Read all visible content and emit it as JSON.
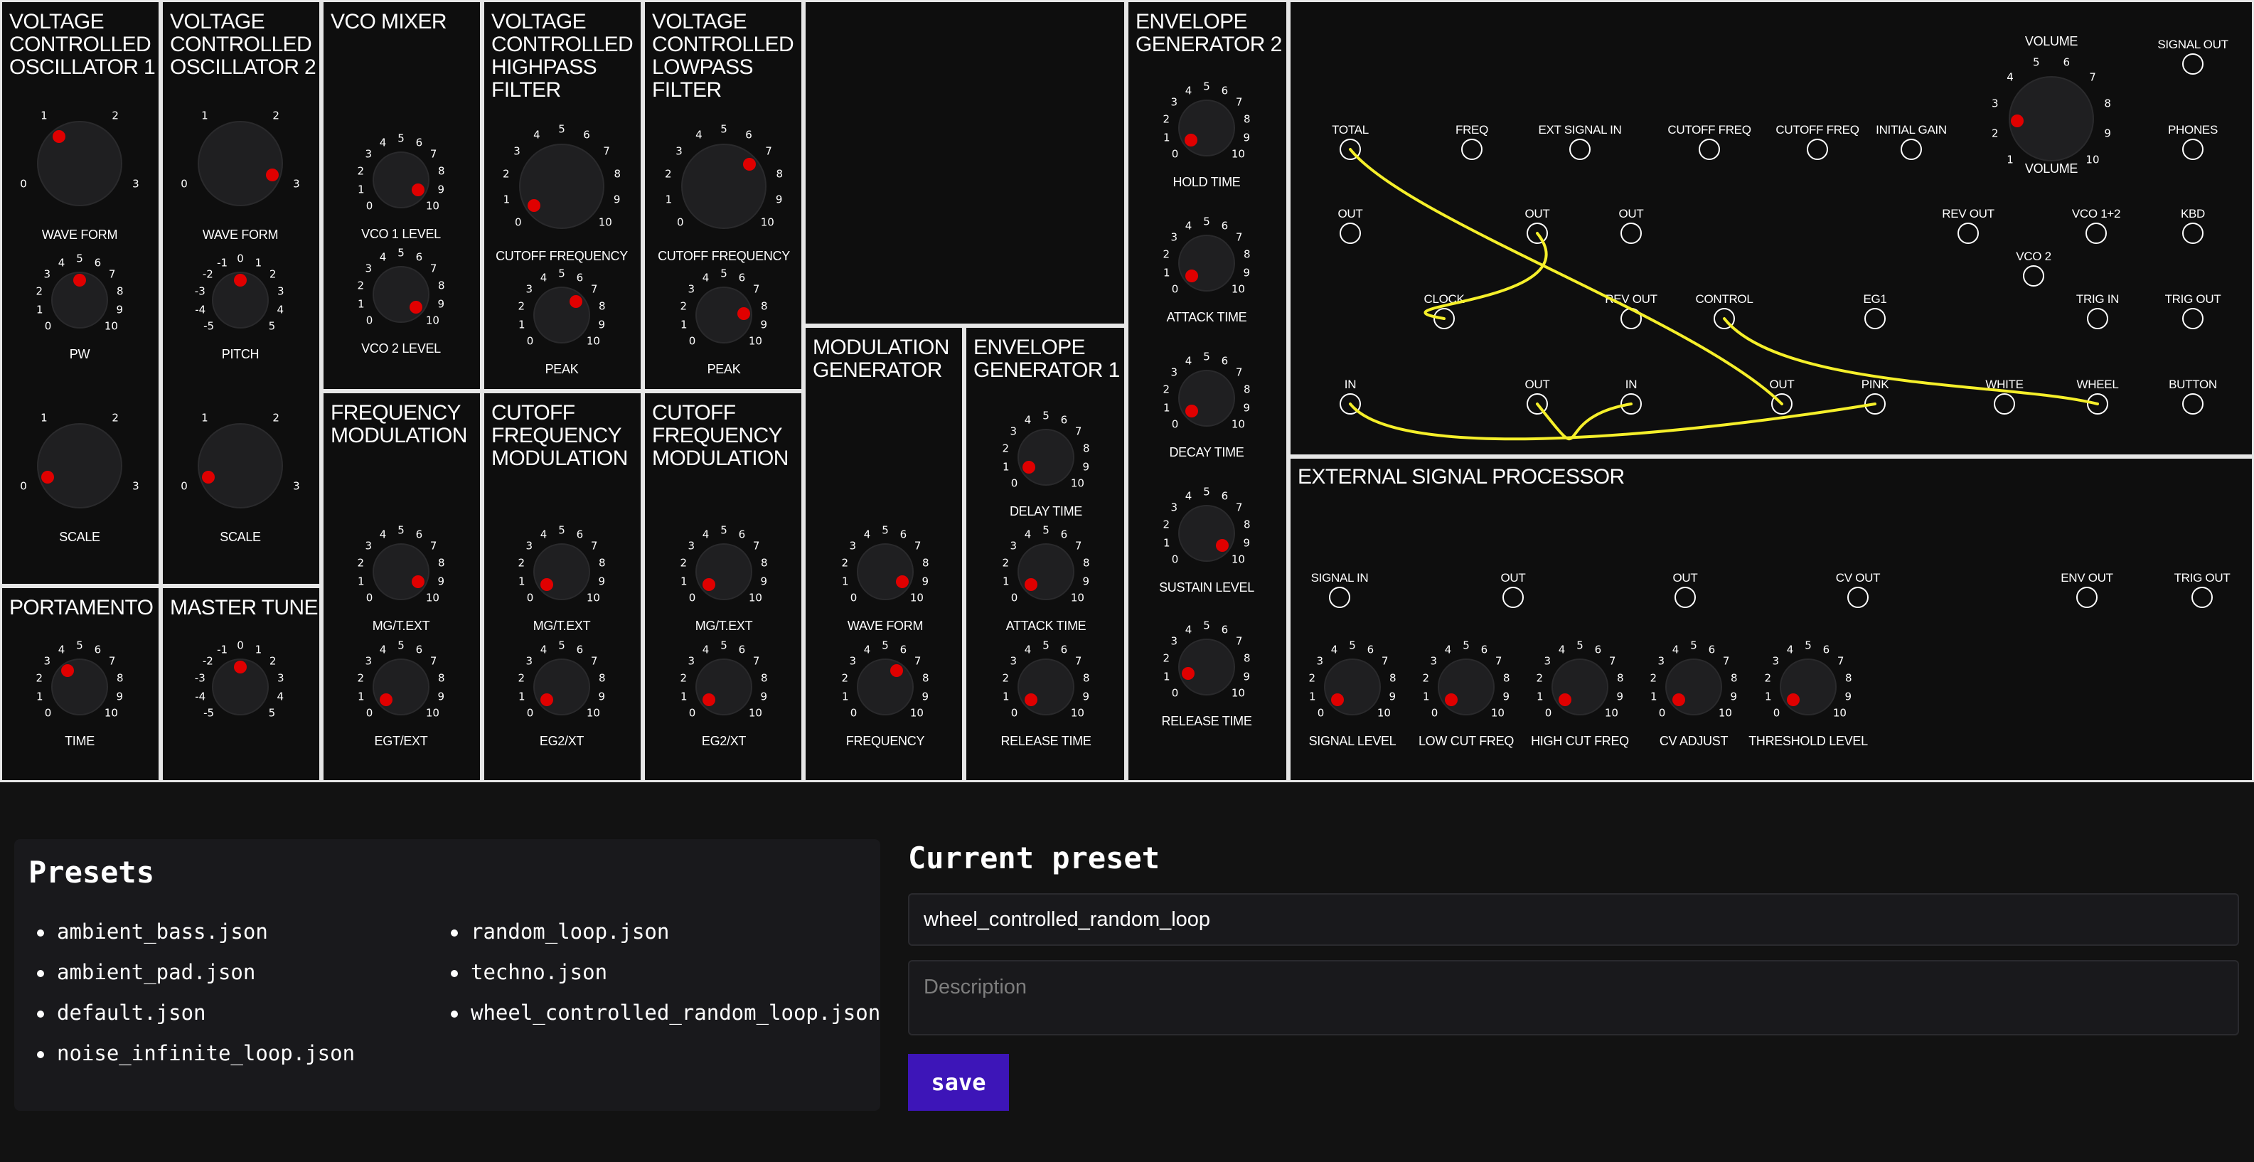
{
  "colors": {
    "background": "#121212",
    "panel": "#0e0e0e",
    "border": "#e6e6e6",
    "knob": "#1f1f21",
    "indicator": "#e00000",
    "cable": "#f5ef2a",
    "save_button": "#3d15b8"
  },
  "modules": {
    "vco1": {
      "title": "VOLTAGE\nCONTROLLED\nOSCILLATOR 1",
      "knobs": [
        {
          "label": "WAVE FORM",
          "ticks": [
            "0",
            "1",
            "2",
            "3"
          ],
          "value": 1
        },
        {
          "label": "PW",
          "ticks": [
            "0",
            "1",
            "2",
            "3",
            "4",
            "5",
            "6",
            "7",
            "8",
            "9",
            "10"
          ],
          "value": 5
        },
        {
          "label": "SCALE",
          "ticks": [
            "0",
            "1",
            "2",
            "3"
          ],
          "value": 0
        }
      ]
    },
    "vco2": {
      "title": "VOLTAGE\nCONTROLLED\nOSCILLATOR 2",
      "knobs": [
        {
          "label": "WAVE FORM",
          "ticks": [
            "0",
            "1",
            "2",
            "3"
          ],
          "value": 3
        },
        {
          "label": "PITCH",
          "ticks": [
            "-5",
            "-4",
            "-3",
            "-2",
            "-1",
            "0",
            "1",
            "2",
            "3",
            "4",
            "5"
          ],
          "value": 0
        },
        {
          "label": "SCALE",
          "ticks": [
            "0",
            "1",
            "2",
            "3"
          ],
          "value": 0
        }
      ]
    },
    "vco_mixer": {
      "title": "VCO MIXER",
      "knobs": [
        {
          "label": "VCO 1 LEVEL",
          "ticks": [
            "0",
            "1",
            "2",
            "3",
            "4",
            "5",
            "6",
            "7",
            "8",
            "9",
            "10"
          ],
          "value": 9.6
        },
        {
          "label": "VCO 2 LEVEL",
          "ticks": [
            "0",
            "1",
            "2",
            "3",
            "4",
            "5",
            "6",
            "7",
            "8",
            "9",
            "10"
          ],
          "value": 10
        }
      ]
    },
    "vchpf": {
      "title": "VOLTAGE\nCONTROLLED\nHIGHPASS\nFILTER",
      "knobs": [
        {
          "label": "CUTOFF FREQUENCY",
          "ticks": [
            "0",
            "1",
            "2",
            "3",
            "4",
            "5",
            "6",
            "7",
            "8",
            "9",
            "10"
          ],
          "value": 0.2
        },
        {
          "label": "PEAK",
          "ticks": [
            "0",
            "1",
            "2",
            "3",
            "4",
            "5",
            "6",
            "7",
            "8",
            "9",
            "10"
          ],
          "value": 6.8
        }
      ]
    },
    "vclpf": {
      "title": "VOLTAGE\nCONTROLLED\nLOWPASS\nFILTER",
      "knobs": [
        {
          "label": "CUTOFF FREQUENCY",
          "ticks": [
            "0",
            "1",
            "2",
            "3",
            "4",
            "5",
            "6",
            "7",
            "8",
            "9",
            "10"
          ],
          "value": 6.9
        },
        {
          "label": "PEAK",
          "ticks": [
            "0",
            "1",
            "2",
            "3",
            "4",
            "5",
            "6",
            "7",
            "8",
            "9",
            "10"
          ],
          "value": 8.3
        }
      ]
    },
    "portamento": {
      "title": "PORTAMENTO",
      "knobs": [
        {
          "label": "TIME",
          "ticks": [
            "0",
            "1",
            "2",
            "3",
            "4",
            "5",
            "6",
            "7",
            "8",
            "9",
            "10"
          ],
          "value": 3.6
        }
      ]
    },
    "master_tune": {
      "title": "MASTER TUNE",
      "knobs": [
        {
          "label": "",
          "ticks": [
            "-5",
            "-4",
            "-3",
            "-2",
            "-1",
            "0",
            "1",
            "2",
            "3",
            "4",
            "5"
          ],
          "value": 0
        }
      ]
    },
    "freq_mod": {
      "title": "FREQUENCY\nMODULATION",
      "knobs": [
        {
          "label": "MG/T.EXT",
          "ticks": [
            "0",
            "1",
            "2",
            "3",
            "4",
            "5",
            "6",
            "7",
            "8",
            "9",
            "10"
          ],
          "value": 9.6
        },
        {
          "label": "EGT/EXT",
          "ticks": [
            "0",
            "1",
            "2",
            "3",
            "4",
            "5",
            "6",
            "7",
            "8",
            "9",
            "10"
          ],
          "value": 0
        }
      ]
    },
    "cutoff_mod1": {
      "title": "CUTOFF\nFREQUENCY\nMODULATION",
      "knobs": [
        {
          "label": "MG/T.EXT",
          "ticks": [
            "0",
            "1",
            "2",
            "3",
            "4",
            "5",
            "6",
            "7",
            "8",
            "9",
            "10"
          ],
          "value": 0
        },
        {
          "label": "EG2/XT",
          "ticks": [
            "0",
            "1",
            "2",
            "3",
            "4",
            "5",
            "6",
            "7",
            "8",
            "9",
            "10"
          ],
          "value": 0
        }
      ]
    },
    "cutoff_mod2": {
      "title": "CUTOFF\nFREQUENCY\nMODULATION",
      "knobs": [
        {
          "label": "MG/T.EXT",
          "ticks": [
            "0",
            "1",
            "2",
            "3",
            "4",
            "5",
            "6",
            "7",
            "8",
            "9",
            "10"
          ],
          "value": 0
        },
        {
          "label": "EG2/XT",
          "ticks": [
            "0",
            "1",
            "2",
            "3",
            "4",
            "5",
            "6",
            "7",
            "8",
            "9",
            "10"
          ],
          "value": 0
        }
      ]
    },
    "mod_gen": {
      "title": "MODULATION\nGENERATOR",
      "knobs": [
        {
          "label": "WAVE FORM",
          "ticks": [
            "0",
            "1",
            "2",
            "3",
            "4",
            "5",
            "6",
            "7",
            "8",
            "9",
            "10"
          ],
          "value": 9.6
        },
        {
          "label": "FREQUENCY",
          "ticks": [
            "0",
            "1",
            "2",
            "3",
            "4",
            "5",
            "6",
            "7",
            "8",
            "9",
            "10"
          ],
          "value": 6.3
        }
      ]
    },
    "env_gen1": {
      "title": "ENVELOPE\nGENERATOR 1",
      "knobs": [
        {
          "label": "DELAY TIME",
          "ticks": [
            "0",
            "1",
            "2",
            "3",
            "4",
            "5",
            "6",
            "7",
            "8",
            "9",
            "10"
          ],
          "value": 0.4
        },
        {
          "label": "ATTACK TIME",
          "ticks": [
            "0",
            "1",
            "2",
            "3",
            "4",
            "5",
            "6",
            "7",
            "8",
            "9",
            "10"
          ],
          "value": 0
        },
        {
          "label": "RELEASE TIME",
          "ticks": [
            "0",
            "1",
            "2",
            "3",
            "4",
            "5",
            "6",
            "7",
            "8",
            "9",
            "10"
          ],
          "value": 0
        }
      ]
    },
    "env_gen2": {
      "title": "ENVELOPE\nGENERATOR 2",
      "knobs": [
        {
          "label": "HOLD TIME",
          "ticks": [
            "0",
            "1",
            "2",
            "3",
            "4",
            "5",
            "6",
            "7",
            "8",
            "9",
            "10"
          ],
          "value": 0.1
        },
        {
          "label": "ATTACK TIME",
          "ticks": [
            "0",
            "1",
            "2",
            "3",
            "4",
            "5",
            "6",
            "7",
            "8",
            "9",
            "10"
          ],
          "value": 0
        },
        {
          "label": "DECAY TIME",
          "ticks": [
            "0",
            "1",
            "2",
            "3",
            "4",
            "5",
            "6",
            "7",
            "8",
            "9",
            "10"
          ],
          "value": 0
        },
        {
          "label": "SUSTAIN LEVEL",
          "ticks": [
            "0",
            "1",
            "2",
            "3",
            "4",
            "5",
            "6",
            "7",
            "8",
            "9",
            "10"
          ],
          "value": 9.9
        },
        {
          "label": "RELEASE TIME",
          "ticks": [
            "0",
            "1",
            "2",
            "3",
            "4",
            "5",
            "6",
            "7",
            "8",
            "9",
            "10"
          ],
          "value": 0.8
        }
      ]
    },
    "esp": {
      "title": "EXTERNAL SIGNAL PROCESSOR",
      "knobs": [
        {
          "label": "SIGNAL LEVEL",
          "ticks": [
            "0",
            "1",
            "2",
            "3",
            "4",
            "5",
            "6",
            "7",
            "8",
            "9",
            "10"
          ],
          "value": 0
        },
        {
          "label": "LOW CUT FREQ",
          "ticks": [
            "0",
            "1",
            "2",
            "3",
            "4",
            "5",
            "6",
            "7",
            "8",
            "9",
            "10"
          ],
          "value": 0
        },
        {
          "label": "HIGH CUT FREQ",
          "ticks": [
            "0",
            "1",
            "2",
            "3",
            "4",
            "5",
            "6",
            "7",
            "8",
            "9",
            "10"
          ],
          "value": 0
        },
        {
          "label": "CV ADJUST",
          "ticks": [
            "0",
            "1",
            "2",
            "3",
            "4",
            "5",
            "6",
            "7",
            "8",
            "9",
            "10"
          ],
          "value": 0
        },
        {
          "label": "THRESHOLD LEVEL",
          "ticks": [
            "0",
            "1",
            "2",
            "3",
            "4",
            "5",
            "6",
            "7",
            "8",
            "9",
            "10"
          ],
          "value": 0
        }
      ]
    }
  },
  "patchbay": {
    "volume": {
      "label": "VOLUME",
      "ticks": [
        "1",
        "2",
        "3",
        "4",
        "5",
        "6",
        "7",
        "8",
        "9",
        "10"
      ],
      "value": 2.4
    },
    "jacks": [
      "SIGNAL OUT",
      "TOTAL",
      "FREQ",
      "EXT SIGNAL IN",
      "CUTOFF FREQ",
      "CUTOFF FREQ",
      "INITIAL GAIN",
      "PHONES",
      "OUT",
      "OUT",
      "OUT",
      "REV OUT",
      "VCO 1+2",
      "KBD",
      "VCO 2",
      "CLOCK",
      "REV OUT",
      "CONTROL",
      "EG1",
      "TRIG IN",
      "TRIG OUT",
      "IN",
      "OUT",
      "IN",
      "OUT",
      "PINK",
      "WHITE",
      "WHEEL",
      "BUTTON"
    ],
    "cables": [
      {
        "from": "TOTAL",
        "to": "OUT"
      },
      {
        "from": "OUT",
        "to": "CLOCK"
      },
      {
        "from": "IN",
        "to": "PINK"
      },
      {
        "from": "OUT",
        "to": "IN"
      },
      {
        "from": "CONTROL",
        "to": "WHEEL"
      }
    ]
  },
  "esp_jacks": [
    "SIGNAL IN",
    "OUT",
    "OUT",
    "CV OUT",
    "ENV OUT",
    "TRIG OUT"
  ],
  "presets": {
    "heading": "Presets",
    "items": [
      "ambient_bass.json",
      "ambient_pad.json",
      "default.json",
      "noise_infinite_loop.json",
      "random_loop.json",
      "techno.json",
      "wheel_controlled_random_loop.json"
    ]
  },
  "current": {
    "heading": "Current preset",
    "name_value": "wheel_controlled_random_loop",
    "description_placeholder": "Description",
    "save_label": "save"
  }
}
